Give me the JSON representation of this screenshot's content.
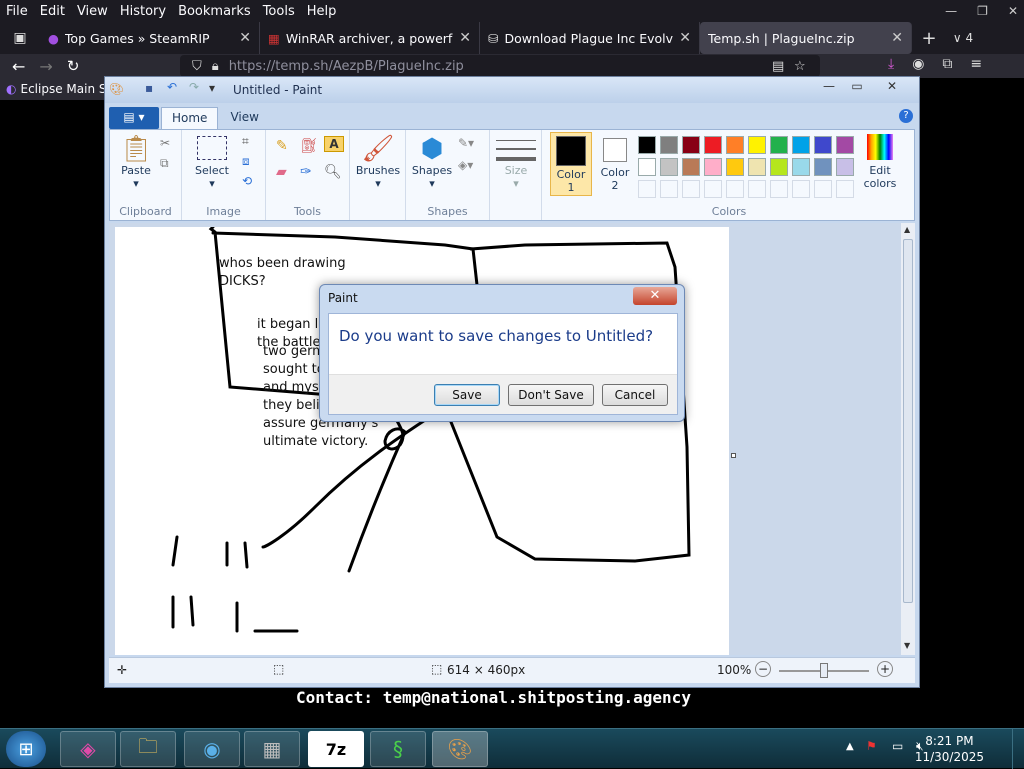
{
  "browser": {
    "menu": [
      "File",
      "Edit",
      "View",
      "History",
      "Bookmarks",
      "Tools",
      "Help"
    ],
    "tabs": [
      {
        "title": "Top Games » SteamRIP",
        "active": false
      },
      {
        "title": "WinRAR archiver, a powerful to",
        "active": false
      },
      {
        "title": "Download Plague Inc Evolved S",
        "active": false
      },
      {
        "title": "Temp.sh | PlagueInc.zip",
        "active": true
      }
    ],
    "tab_count": "4",
    "url": "https://temp.sh/AezpB/PlagueInc.zip",
    "bookmark": "Eclipse Main S"
  },
  "paint": {
    "title": "Untitled - Paint",
    "ribbon_tabs": [
      "Home",
      "View"
    ],
    "groups": {
      "clipboard": "Clipboard",
      "image": "Image",
      "tools": "Tools",
      "shapes": "Shapes",
      "colors": "Colors"
    },
    "buttons": {
      "paste": "Paste",
      "select": "Select",
      "brushes": "Brushes",
      "shapes": "Shapes",
      "size": "Size",
      "color1": "Color\n1",
      "color1_a": "Color",
      "color1_b": "1",
      "color2_a": "Color",
      "color2_b": "2",
      "edit_colors_a": "Edit",
      "edit_colors_b": "colors"
    },
    "palette_row1": [
      "#000000",
      "#7f7f7f",
      "#880015",
      "#ed1c24",
      "#ff7f27",
      "#fff200",
      "#22b14c",
      "#00a2e8",
      "#3f48cc",
      "#a349a4"
    ],
    "palette_row2": [
      "#ffffff",
      "#c3c3c3",
      "#b97a57",
      "#ffaec9",
      "#ffc90e",
      "#efe4b0",
      "#b5e61d",
      "#99d9ea",
      "#7092be",
      "#c8bfe7"
    ],
    "canvas_text": {
      "t1": "whos been drawing",
      "t2": "DICKS?",
      "t3": "it began lo",
      "t4": "the battlef",
      "t5": "two germ",
      "t6": "sought to",
      "t7": "and myste",
      "t8": "they belie",
      "t9": "assure germany's",
      "t10": "ultimate victory."
    },
    "status": {
      "dimensions": "614 × 460px",
      "zoom": "100%"
    }
  },
  "dialog": {
    "title": "Paint",
    "message": "Do you want to save changes to Untitled?",
    "save": "Save",
    "dont_save": "Don't Save",
    "cancel": "Cancel"
  },
  "contact": "Contact: temp@national.shitposting.agency",
  "taskbar": {
    "time": "8:21 PM",
    "date": "11/30/2025"
  }
}
